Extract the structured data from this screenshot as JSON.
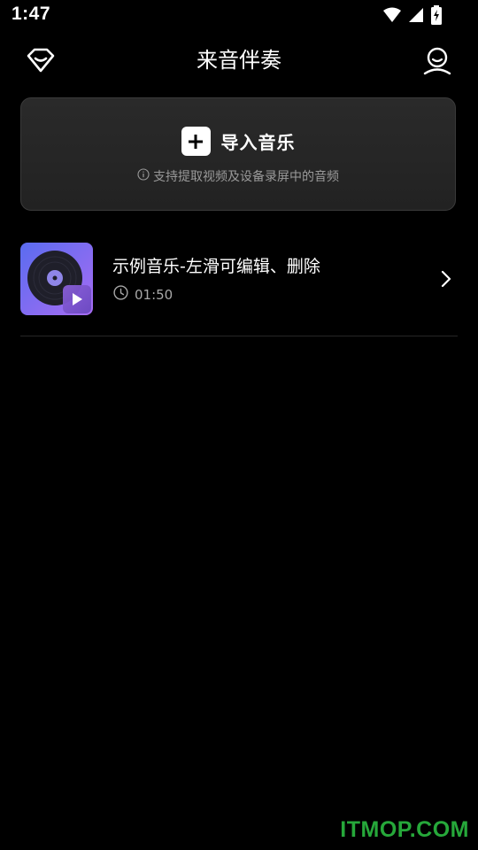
{
  "status_bar": {
    "time": "1:47",
    "icons": [
      "wifi-icon",
      "cell-signal-icon",
      "battery-charging-icon"
    ]
  },
  "header": {
    "title": "来音伴奏",
    "left_icon": "diamond-vip-icon",
    "right_icon": "user-profile-icon"
  },
  "import_card": {
    "label": "导入音乐",
    "hint": "支持提取视频及设备录屏中的音频",
    "icon": "plus-icon",
    "hint_icon": "info-icon"
  },
  "songs": [
    {
      "title": "示例音乐-左滑可编辑、删除",
      "duration": "01:50",
      "cover_icon": "vinyl-record-icon",
      "duration_icon": "clock-icon"
    }
  ],
  "watermark": "ITMOP.COM",
  "colors": {
    "background": "#000000",
    "card": "#262626",
    "text_secondary": "#9a9a9a",
    "cover_start": "#5a6cf0",
    "cover_end": "#a76cf2",
    "watermark": "#26a83a"
  }
}
